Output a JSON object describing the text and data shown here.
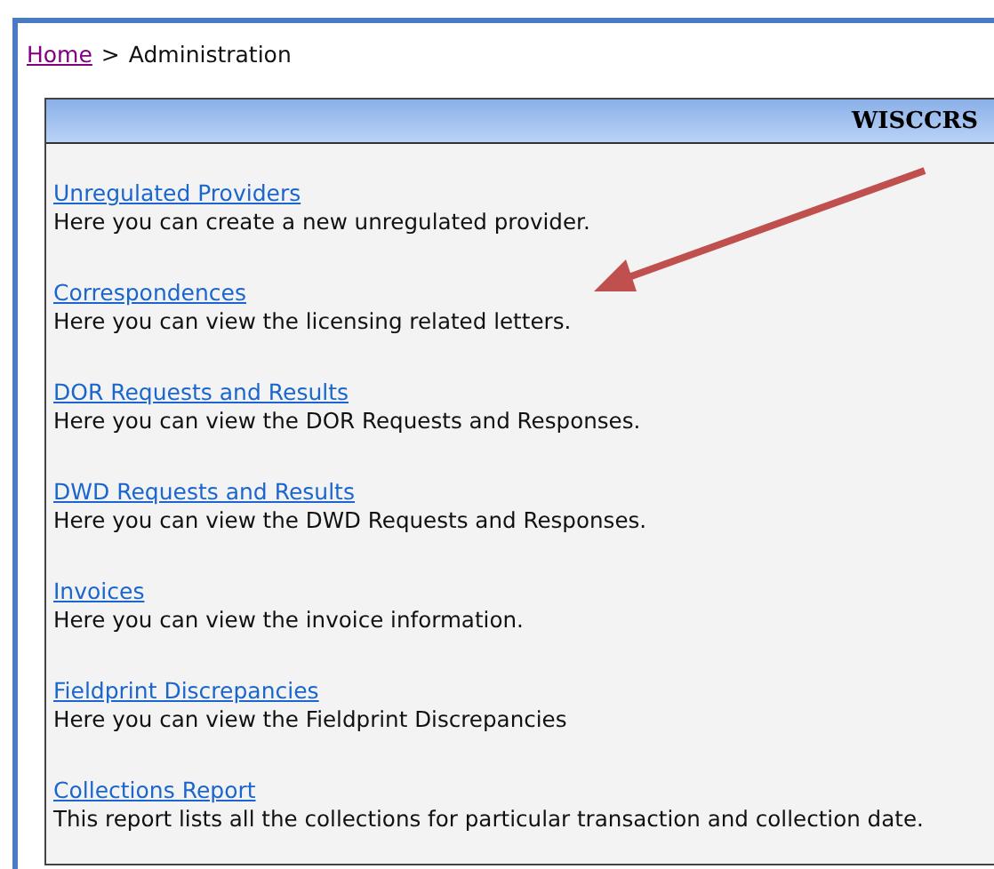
{
  "breadcrumb": {
    "home": "Home",
    "separator": ">",
    "current": "Administration"
  },
  "panel": {
    "title": "WISCCRS"
  },
  "items": [
    {
      "link": "Unregulated Providers",
      "description": "Here you can create a new unregulated provider."
    },
    {
      "link": "Correspondences",
      "description": "Here you can view the licensing related letters."
    },
    {
      "link": "DOR Requests and Results",
      "description": "Here you can view the DOR Requests and Responses."
    },
    {
      "link": "DWD Requests and Results",
      "description": "Here you can view the DWD Requests and Responses."
    },
    {
      "link": "Invoices",
      "description": "Here you can view the invoice information."
    },
    {
      "link": "Fieldprint Discrepancies",
      "description": "Here you can view the Fieldprint Discrepancies"
    },
    {
      "link": "Collections Report",
      "description": "This report lists all the collections for particular transaction and collection date."
    }
  ]
}
